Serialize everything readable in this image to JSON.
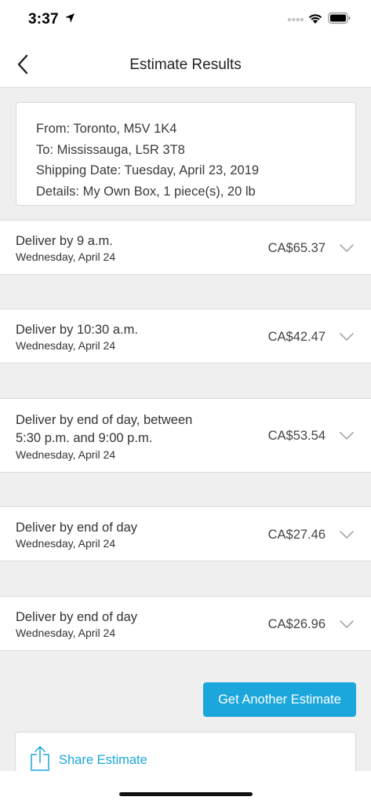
{
  "status_bar": {
    "time": "3:37"
  },
  "header": {
    "title": "Estimate Results"
  },
  "summary": {
    "from": "From: Toronto, M5V 1K4",
    "to": "To: Mississauga, L5R 3T8",
    "shipping_date": "Shipping Date: Tuesday, April 23, 2019",
    "details": "Details: My Own Box, 1 piece(s), 20 lb"
  },
  "options": [
    {
      "title": "Deliver by 9 a.m.",
      "date": "Wednesday, April 24",
      "price": "CA$65.37"
    },
    {
      "title": "Deliver by 10:30 a.m.",
      "date": "Wednesday, April 24",
      "price": "CA$42.47"
    },
    {
      "title_line1": "Deliver by end of day, between",
      "title_line2": "5:30 p.m. and 9:00 p.m.",
      "date": "Wednesday, April 24",
      "price": "CA$53.54"
    },
    {
      "title": "Deliver by end of day",
      "date": "Wednesday, April 24",
      "price": "CA$27.46"
    },
    {
      "title": "Deliver by end of day",
      "date": "Wednesday, April 24",
      "price": "CA$26.96"
    }
  ],
  "actions": {
    "get_estimate_label": "Get Another Estimate",
    "share_label": "Share Estimate"
  },
  "colors": {
    "accent": "#1ba6dc",
    "background": "#efefef"
  },
  "icons": [
    "location-arrow-icon",
    "signal-dots-icon",
    "wifi-icon",
    "battery-icon",
    "back-chevron-icon",
    "chevron-down-icon",
    "share-icon"
  ]
}
